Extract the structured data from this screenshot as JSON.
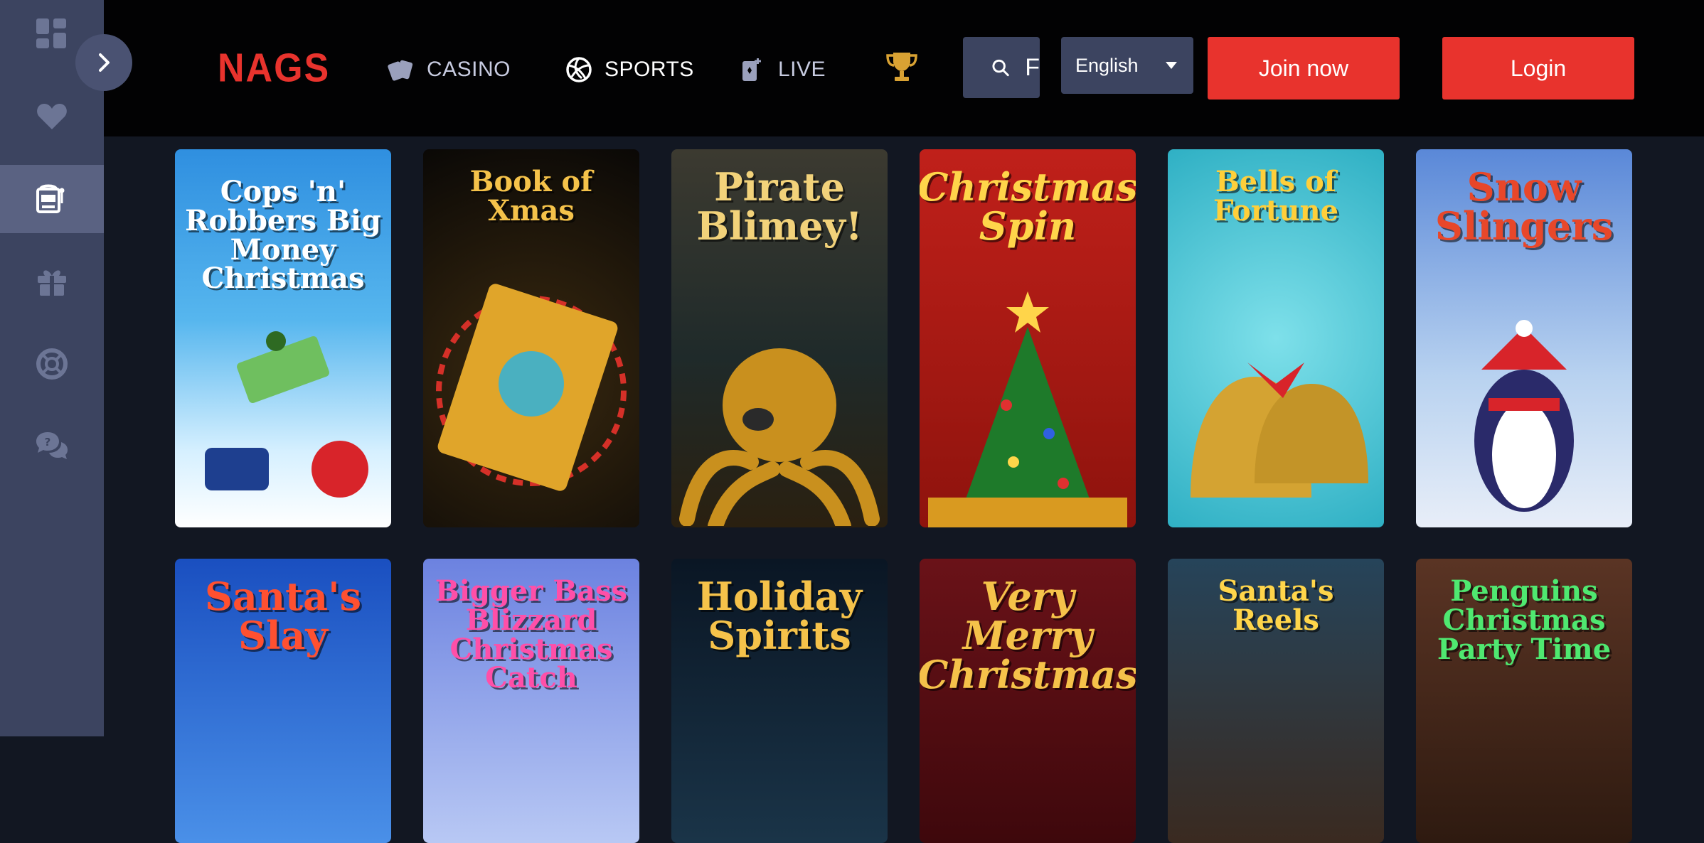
{
  "header": {
    "logo": "NAGS",
    "nav": [
      {
        "label": "CASINO",
        "color": "#c7cbe0"
      },
      {
        "label": "SPORTS",
        "color": "#ffffff"
      },
      {
        "label": "LIVE",
        "color": "#c7cbe0"
      }
    ],
    "search_placeholder": "F",
    "language": "English",
    "join_label": "Join now",
    "login_label": "Login"
  },
  "sidebar": {
    "items": [
      {
        "icon": "dashboard-icon"
      },
      {
        "icon": "heart-icon"
      },
      {
        "icon": "slot-machine-icon",
        "active": true
      },
      {
        "icon": "gift-icon"
      },
      {
        "icon": "lifebuoy-icon"
      },
      {
        "icon": "chat-bubbles-icon"
      }
    ]
  },
  "games": [
    {
      "title": "Cops 'n' Robbers Big Money Christmas",
      "bg": "#3aa3e8",
      "color": "#ffffff"
    },
    {
      "title": "Book of Xmas",
      "bg": "#1a1410",
      "color": "#f5c24a"
    },
    {
      "title": "Pirate Blimey!",
      "bg": "#3a3526",
      "color": "#f2d27a"
    },
    {
      "title": "Christmas Spin",
      "bg": "#b31a10",
      "color": "#ffd54a"
    },
    {
      "title": "Bells of Fortune",
      "bg": "#4cc0d2",
      "color": "#ffcf3a"
    },
    {
      "title": "Snow Slingers",
      "bg": "#a8c8ea",
      "color": "#e8472a"
    },
    {
      "title": "Santa's Slay",
      "bg": "#2a6ad8",
      "color": "#ff5030"
    },
    {
      "title": "Bigger Bass Blizzard Christmas Catch",
      "bg": "#8aa6ea",
      "color": "#ff4fa8"
    },
    {
      "title": "Holiday Spirits",
      "bg": "#0d1e2e",
      "color": "#f5c24a"
    },
    {
      "title": "Very Merry Christmas",
      "bg": "#5a0e12",
      "color": "#f5c24a"
    },
    {
      "title": "Santa's Reels",
      "bg": "#1c3a40",
      "color": "#ffd54a"
    },
    {
      "title": "Penguins Christmas Party Time",
      "bg": "#3e2418",
      "color": "#4fe870"
    }
  ]
}
